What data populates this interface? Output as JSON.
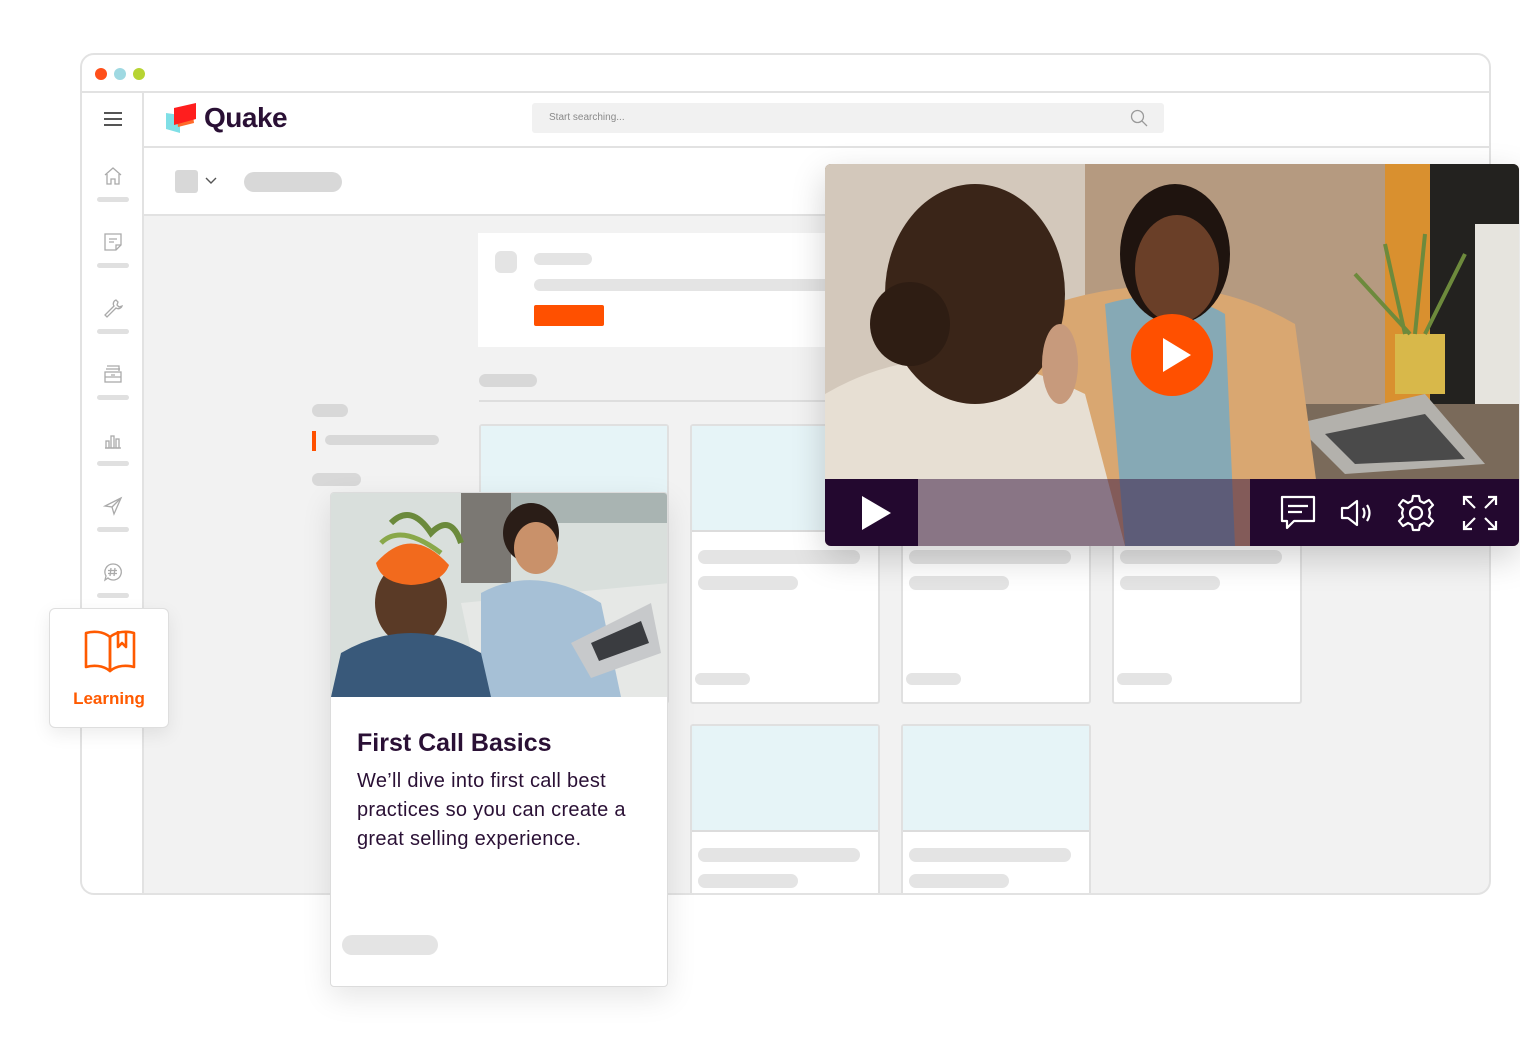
{
  "window": {
    "traffic_lights": [
      {
        "name": "close",
        "color": "#ff4f1a"
      },
      {
        "name": "minimize",
        "color": "#9fd9e2"
      },
      {
        "name": "maximize",
        "color": "#b7d433"
      }
    ]
  },
  "brand": {
    "name": "Quake",
    "accent": "#ff5000",
    "dark": "#2a1035"
  },
  "search": {
    "placeholder": "Start searching...",
    "icon": "search-icon"
  },
  "sidebar": {
    "menu_icon": "hamburger-icon",
    "items": [
      {
        "id": "home",
        "icon": "home-icon"
      },
      {
        "id": "notes",
        "icon": "note-icon"
      },
      {
        "id": "tools",
        "icon": "wrench-icon"
      },
      {
        "id": "files",
        "icon": "file-cabinet-icon"
      },
      {
        "id": "analytics",
        "icon": "bar-chart-icon"
      },
      {
        "id": "send",
        "icon": "paper-plane-icon"
      },
      {
        "id": "channels",
        "icon": "hashtag-chat-icon"
      }
    ],
    "active_item": {
      "label": "Learning",
      "icon": "book-icon"
    }
  },
  "course_card": {
    "title": "First Call Basics",
    "description": "We’ll dive into first call best practices so you can create a great selling experience."
  },
  "video_player": {
    "state": "paused",
    "controls": [
      {
        "id": "play",
        "icon": "play-icon"
      },
      {
        "id": "captions",
        "icon": "captions-icon"
      },
      {
        "id": "volume",
        "icon": "volume-icon"
      },
      {
        "id": "settings",
        "icon": "gear-icon"
      },
      {
        "id": "fullscreen",
        "icon": "expand-icon"
      }
    ]
  }
}
